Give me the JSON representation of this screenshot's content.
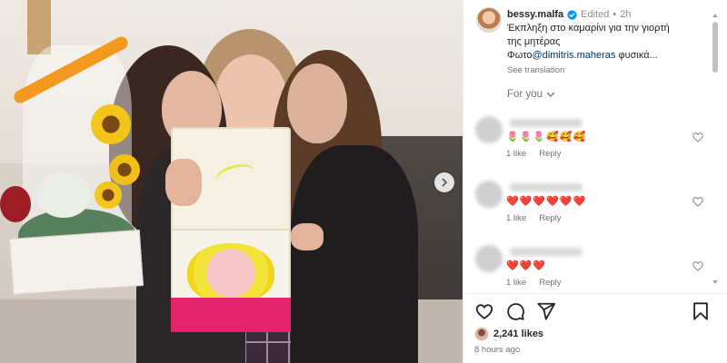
{
  "post": {
    "username": "bessy.malfa",
    "edited_label": "Edited",
    "dot": "•",
    "time_posted": "2h",
    "caption_line1": "Έκπληξη στο καμαρίνι για την γιορτή",
    "caption_line2": "της μητέρας",
    "caption_prefix": "Φωτο",
    "mention": "@dimitris.maheras",
    "caption_suffix": " φυσικά...",
    "see_translation": "See translation",
    "for_you": "For you"
  },
  "comments": [
    {
      "emojis": "🌷🌷🌷🥰🥰🥰",
      "likes": "1 like",
      "reply": "Reply"
    },
    {
      "emojis": "❤️❤️❤️❤️❤️❤️",
      "likes": "1 like",
      "reply": "Reply"
    },
    {
      "emojis": "❤️❤️❤️",
      "likes": "1 like",
      "reply": "Reply"
    }
  ],
  "footer": {
    "likes_count": "2,241 likes",
    "time_ago": "8 hours ago"
  },
  "colors": {
    "verified": "#0095f6",
    "mention": "#00376b",
    "muted": "#737373"
  },
  "icons": {
    "next": "chevron-right-icon",
    "like": "heart-icon",
    "comment": "comment-icon",
    "share": "share-icon",
    "save": "bookmark-icon",
    "verified": "verified-badge-icon"
  }
}
